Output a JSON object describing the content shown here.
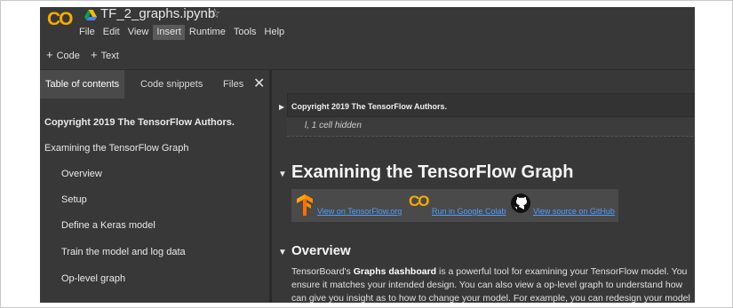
{
  "app": {
    "logo_text": "CO",
    "notebook_title": "TF_2_graphs.ipynb",
    "star_icon": "☆",
    "menu": [
      "File",
      "Edit",
      "View",
      "Insert",
      "Runtime",
      "Tools",
      "Help"
    ],
    "menu_active": "Insert"
  },
  "toolbar": {
    "add_code_label": "Code",
    "add_text_label": "Text",
    "plus": "+"
  },
  "sidebar": {
    "tabs": [
      "Table of contents",
      "Code snippets",
      "Files"
    ],
    "close_icon": "✕",
    "toc": [
      {
        "label": "Copyright 2019 The TensorFlow Authors.",
        "level": 0,
        "bold": true
      },
      {
        "label": "Examining the TensorFlow Graph",
        "level": 0,
        "bold": false
      },
      {
        "label": "Overview",
        "level": 1,
        "bold": false
      },
      {
        "label": "Setup",
        "level": 1,
        "bold": false
      },
      {
        "label": "Define a Keras model",
        "level": 1,
        "bold": false
      },
      {
        "label": "Train the model and log data",
        "level": 1,
        "bold": false
      },
      {
        "label": "Op-level graph",
        "level": 1,
        "bold": false
      }
    ]
  },
  "main": {
    "copyright_heading": "Copyright 2019 The TensorFlow Authors.",
    "hidden_cells": "l, 1 cell hidden",
    "title": "Examining the TensorFlow Graph",
    "links": {
      "tensorflow": "View on TensorFlow.org",
      "colab": "Run in Google Colab",
      "github": "View source on GitHub"
    },
    "overview_heading": "Overview",
    "overview_bold": "Graphs dashboard",
    "overview_pre": "TensorBoard's ",
    "overview_post": " is a powerful tool for examining your TensorFlow model. You ensure it matches your intended design. You can also view a op-level graph to understand how can give you insight as to how to change your model. For example, you can redesign your model"
  },
  "colors": {
    "background": "#383838",
    "accent": "#f9ab00",
    "link": "#4f9dff"
  }
}
